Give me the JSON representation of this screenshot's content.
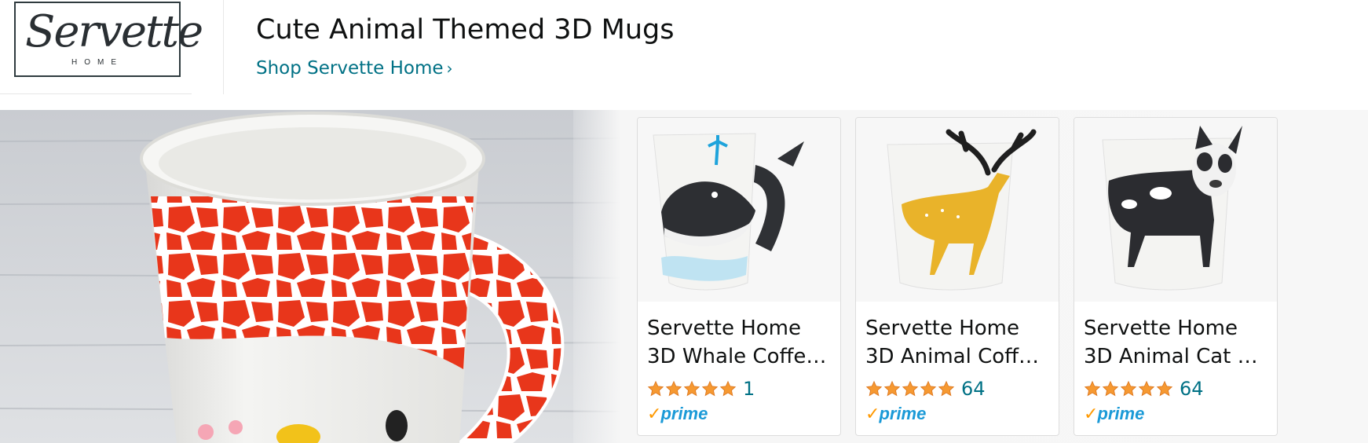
{
  "brand": {
    "logo_script": "Servette",
    "logo_sub": "HOME"
  },
  "header": {
    "headline": "Cute Animal Themed 3D Mugs",
    "shop_link": "Shop Servette Home",
    "chevron_icon": "chevron-right-icon"
  },
  "hero": {
    "image_subject": "giraffe-mug-photo"
  },
  "products": [
    {
      "title_line1": "Servette Home",
      "title_line2": "3D Whale Coffe…",
      "rating": 5,
      "rating_count": "1",
      "prime": "prime",
      "image_subject": "whale-mug-image"
    },
    {
      "title_line1": "Servette Home",
      "title_line2": "3D Animal Coff…",
      "rating": 5,
      "rating_count": "64",
      "prime": "prime",
      "image_subject": "deer-mug-image"
    },
    {
      "title_line1": "Servette Home",
      "title_line2": "3D Animal Cat L…",
      "rating": 5,
      "rating_count": "64",
      "prime": "prime",
      "image_subject": "dog-mug-image"
    }
  ],
  "colors": {
    "link": "#007185",
    "star": "#f69931",
    "prime_check": "#ff9900",
    "prime_word": "#1b9ad7",
    "giraffe_red": "#e8361b"
  }
}
